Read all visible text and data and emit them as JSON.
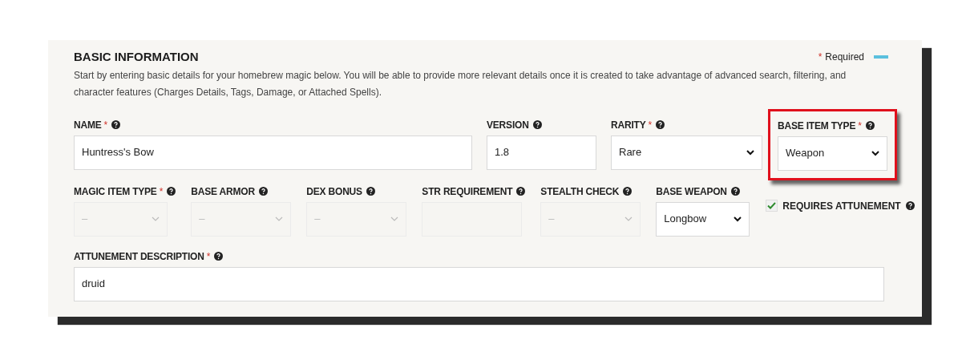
{
  "section": {
    "title": "BASIC INFORMATION",
    "required_legend": "Required",
    "required_mark": "*",
    "description": "Start by entering basic details for your homebrew magic below. You will be able to provide more relevant details once it is created to take advantage of advanced search, filtering, and character features (Charges Details, Tags, Damage, or Attached Spells)."
  },
  "rows": [
    [
      {
        "kind": "text",
        "label": "NAME",
        "required": true,
        "value": "Huntress's Bow",
        "disabled": false,
        "highlighted": false
      },
      {
        "kind": "text",
        "label": "VERSION",
        "required": false,
        "value": "1.8",
        "disabled": false,
        "highlighted": false
      },
      {
        "kind": "select",
        "label": "RARITY",
        "required": true,
        "value": "Rare",
        "disabled": false,
        "highlighted": false
      },
      {
        "kind": "select",
        "label": "BASE ITEM TYPE",
        "required": true,
        "value": "Weapon",
        "disabled": false,
        "highlighted": true
      }
    ],
    [
      {
        "kind": "select",
        "label": "MAGIC ITEM TYPE",
        "required": true,
        "value": "–",
        "disabled": true,
        "highlighted": false
      },
      {
        "kind": "select",
        "label": "BASE ARMOR",
        "required": false,
        "value": "–",
        "disabled": true,
        "highlighted": false
      },
      {
        "kind": "select",
        "label": "DEX BONUS",
        "required": false,
        "value": "–",
        "disabled": true,
        "highlighted": false
      },
      {
        "kind": "text",
        "label": "STR REQUIREMENT",
        "required": false,
        "disabled": true,
        "highlighted": false
      },
      {
        "kind": "select",
        "label": "STEALTH CHECK",
        "required": false,
        "value": "–",
        "disabled": true,
        "highlighted": false
      },
      {
        "kind": "select",
        "label": "BASE WEAPON",
        "required": false,
        "value": "Longbow",
        "disabled": false,
        "highlighted": false
      },
      {
        "kind": "checkbox",
        "label": "REQUIRES ATTUNEMENT",
        "checked": true
      }
    ],
    [
      {
        "kind": "text",
        "label": "ATTUNEMENT DESCRIPTION",
        "required": true,
        "value": "druid",
        "disabled": false,
        "highlighted": false
      }
    ]
  ]
}
